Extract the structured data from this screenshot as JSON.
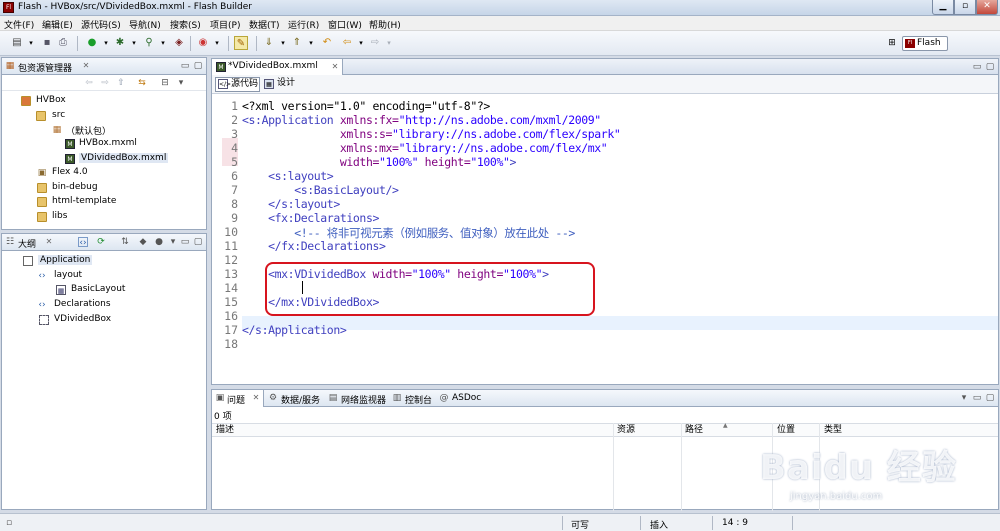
{
  "window": {
    "title": "Flash  -  HVBox/src/VDividedBox.mxml  -  Flash Builder",
    "app_icon": "Fl",
    "minimize_icon": "minimize-icon",
    "maximize_icon": "maximize-icon",
    "close_icon": "close-icon"
  },
  "menu": [
    "文件(F)",
    "编辑(E)",
    "源代码(S)",
    "导航(N)",
    "搜索(S)",
    "项目(P)",
    "数据(T)",
    "运行(R)",
    "窗口(W)",
    "帮助(H)"
  ],
  "toolbar": {
    "perspective_label": "Flash",
    "perspective_icon": "Fl"
  },
  "package_explorer": {
    "title": "包资源管理器",
    "items": [
      "HVBox",
      "src",
      "（默认包）",
      "HVBox.mxml",
      "VDividedBox.mxml",
      "Flex 4.0",
      "bin-debug",
      "html-template",
      "libs"
    ]
  },
  "outline": {
    "title": "大纲",
    "items": [
      "Application",
      "layout",
      "BasicLayout",
      "Declarations",
      "VDividedBox"
    ]
  },
  "editor": {
    "tab_label": "*VDividedBox.mxml",
    "mode_source": "源代码",
    "mode_design": "设计",
    "lines": [
      "1",
      "2",
      "3",
      "4",
      "5",
      "6",
      "7",
      "8",
      "9",
      "10",
      "11",
      "12",
      "13",
      "14",
      "15",
      "16",
      "17",
      "18"
    ],
    "code": {
      "l1": "<?xml version=\"1.0\" encoding=\"utf-8\"?>",
      "l2a": "<s:Application",
      "l2b": " xmlns:fx=",
      "l2c": "\"http://ns.adobe.com/mxml/2009\"",
      "l3b": "               xmlns:s=",
      "l3c": "\"library://ns.adobe.com/flex/spark\"",
      "l4b": "               xmlns:mx=",
      "l4c": "\"library://ns.adobe.com/flex/mx\"",
      "l5b": "               width=",
      "l5c": "\"100%\"",
      "l5d": " height=",
      "l5e": "\"100%\"",
      "l5f": ">",
      "l6": "    <s:layout>",
      "l7": "        <s:BasicLayout/>",
      "l8": "    </s:layout>",
      "l9": "    <fx:Declarations>",
      "l10": "        <!-- 将非可视元素（例如服务、值对象）放在此处 -->",
      "l11": "    </fx:Declarations>",
      "l13a": "    <mx:VDividedBox",
      "l13b": " width=",
      "l13c": "\"100%\"",
      "l13d": " height=",
      "l13e": "\"100%\"",
      "l13f": ">",
      "l15": "    </mx:VDividedBox>",
      "l17": "</s:Application>"
    }
  },
  "bottom_panel": {
    "tabs": [
      "问题",
      "数据/服务",
      "网络监视器",
      "控制台",
      "ASDoc"
    ],
    "count": "0 项",
    "columns": [
      "描述",
      "资源",
      "路径",
      "位置",
      "类型"
    ]
  },
  "statusbar": {
    "writable": "可写",
    "insert_mode": "插入",
    "position": "14 : 9"
  },
  "watermark": {
    "logo": "Baidu 经验",
    "url": "jingyan.baidu.com"
  }
}
